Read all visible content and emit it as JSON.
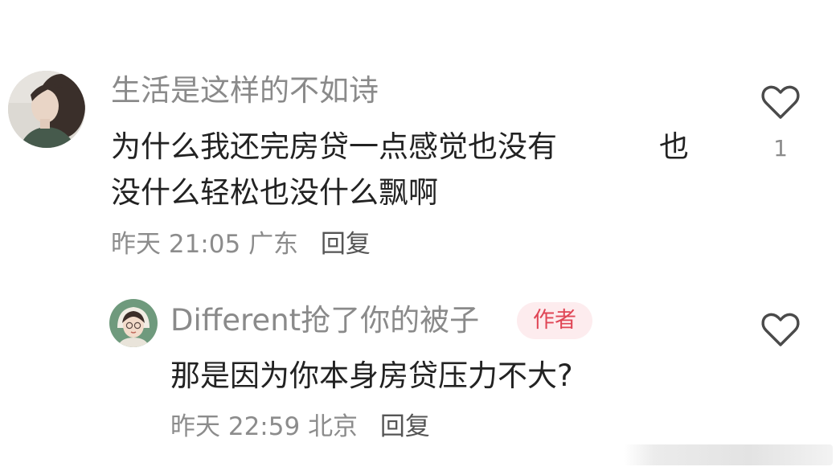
{
  "comments": [
    {
      "username": "生活是这样的不如诗",
      "content_line1": "为什么我还完房贷一点感觉也没有",
      "content_trail": "也",
      "content_line2": "没什么轻松也没什么飘啊",
      "time": "昨天 21:05",
      "location": "广东",
      "reply_label": "回复",
      "like_count": "1",
      "icons": {
        "like": "heart-outline-icon",
        "avatar": "avatar-photo"
      }
    }
  ],
  "replies": [
    {
      "username": "Different抢了你的被子",
      "badge": "作者",
      "content": "那是因为你本身房贷压力不大?",
      "time": "昨天 22:59",
      "location": "北京",
      "reply_label": "回复",
      "icons": {
        "like": "heart-outline-icon",
        "avatar": "avatar-illustration"
      }
    }
  ],
  "colors": {
    "username": "#8a8a8a",
    "content": "#222222",
    "meta": "#8c8c8c",
    "badge_bg": "#fdecee",
    "badge_text": "#e04656"
  }
}
